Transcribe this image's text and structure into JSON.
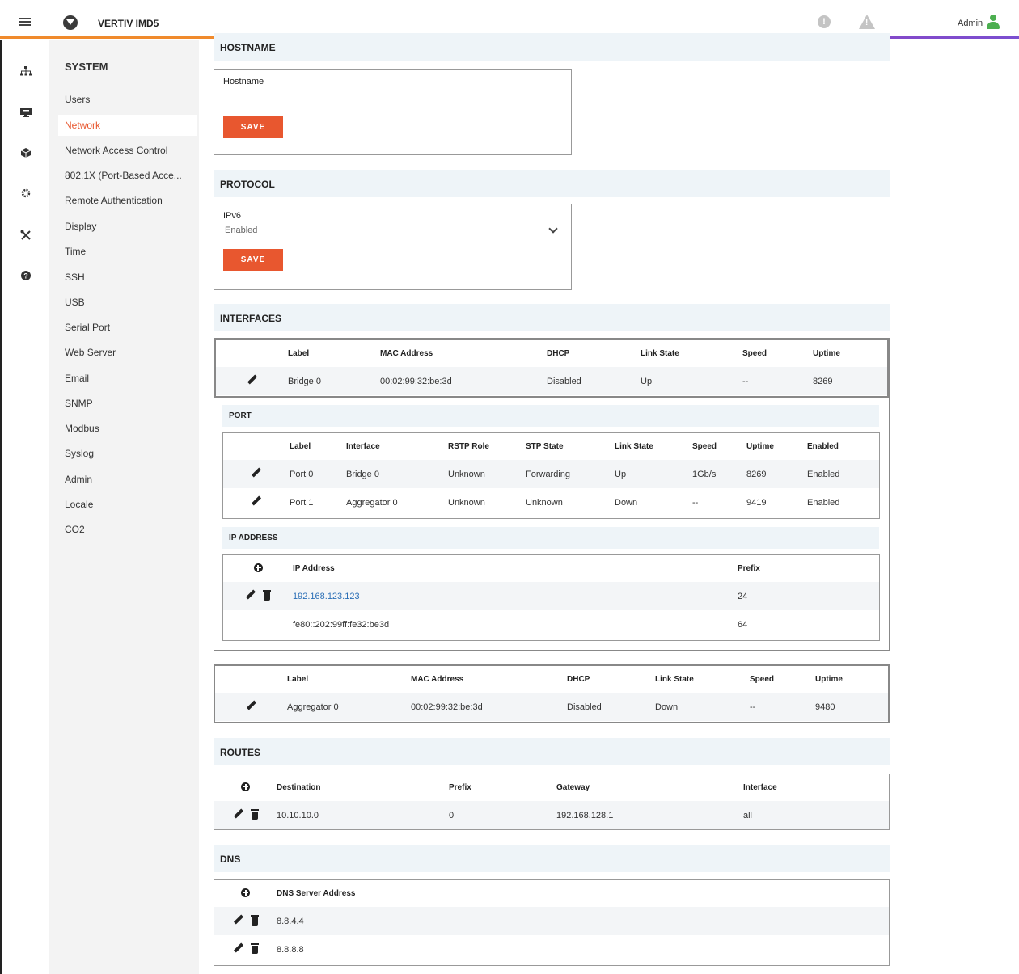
{
  "topbar": {
    "app_title": "VERTIV IMD5",
    "user_label": "Admin"
  },
  "rail": {
    "icons": [
      "sitemap-icon",
      "monitor-icon",
      "cube-icon",
      "gear-icon",
      "tools-icon",
      "help-icon"
    ]
  },
  "subnav": {
    "title": "SYSTEM",
    "items": [
      "Users",
      "Network",
      "Network Access Control",
      "802.1X (Port-Based Acce...",
      "Remote Authentication",
      "Display",
      "Time",
      "SSH",
      "USB",
      "Serial Port",
      "Web Server",
      "Email",
      "SNMP",
      "Modbus",
      "Syslog",
      "Admin",
      "Locale",
      "CO2"
    ],
    "active": "Network"
  },
  "hostname": {
    "header": "HOSTNAME",
    "label": "Hostname",
    "value": "",
    "save": "SAVE"
  },
  "protocol": {
    "header": "PROTOCOL",
    "label": "IPv6",
    "value": "Enabled",
    "save": "SAVE"
  },
  "interfaces": {
    "header": "INTERFACES",
    "columns": [
      "Label",
      "MAC Address",
      "DHCP",
      "Link State",
      "Speed",
      "Uptime"
    ],
    "bridge": [
      "Bridge 0",
      "00:02:99:32:be:3d",
      "Disabled",
      "Up",
      "--",
      "8269"
    ],
    "port_header": "PORT",
    "port_columns": [
      "Label",
      "Interface",
      "RSTP Role",
      "STP State",
      "Link State",
      "Speed",
      "Uptime",
      "Enabled"
    ],
    "ports": [
      [
        "Port 0",
        "Bridge 0",
        "Unknown",
        "Forwarding",
        "Up",
        "1Gb/s",
        "8269",
        "Enabled"
      ],
      [
        "Port 1",
        "Aggregator 0",
        "Unknown",
        "Unknown",
        "Down",
        "--",
        "9419",
        "Enabled"
      ]
    ],
    "ip_header": "IP ADDRESS",
    "ip_columns": [
      "IP Address",
      "Prefix"
    ],
    "ips": [
      [
        "192.168.123.123",
        "24"
      ],
      [
        "fe80::202:99ff:fe32:be3d",
        "64"
      ]
    ],
    "aggregator": [
      "Aggregator 0",
      "00:02:99:32:be:3d",
      "Disabled",
      "Down",
      "--",
      "9480"
    ]
  },
  "routes": {
    "header": "ROUTES",
    "columns": [
      "Destination",
      "Prefix",
      "Gateway",
      "Interface"
    ],
    "rows": [
      [
        "10.10.10.0",
        "0",
        "192.168.128.1",
        "all"
      ]
    ]
  },
  "dns": {
    "header": "DNS",
    "column": "DNS Server Address",
    "rows": [
      "8.8.4.4",
      "8.8.8.8"
    ]
  },
  "colors": {
    "accent": "#e8572f",
    "link": "#2a6eb6",
    "section_bg": "#eef4f8",
    "user": "#4caf50"
  }
}
